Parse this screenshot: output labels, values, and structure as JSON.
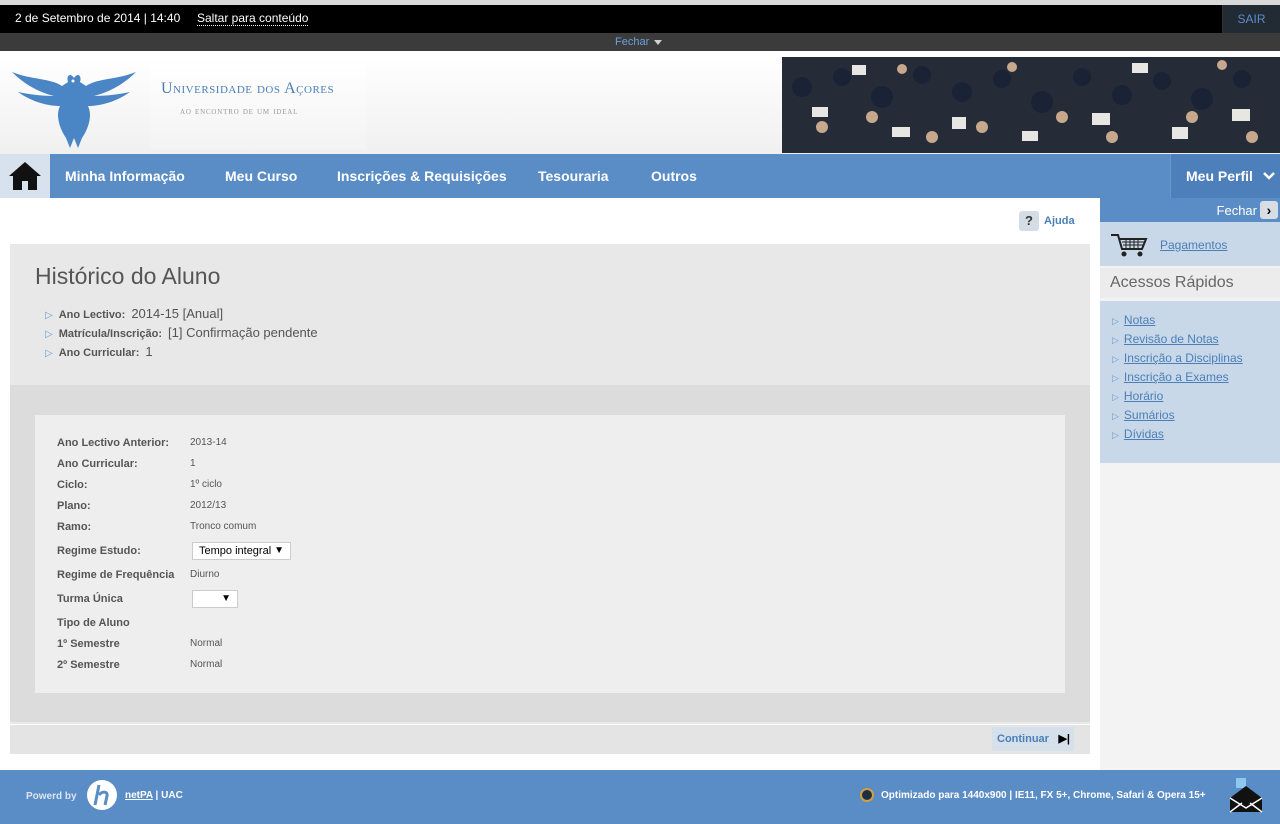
{
  "topbar": {
    "date": "2 de Setembro de 2014 | 14:40",
    "skip_link": "Saltar para conteúdo",
    "logout": "SAIR",
    "close_label": "Fechar"
  },
  "header": {
    "university_name": "Universidade dos Açores",
    "motto": "ao encontro de um ideal"
  },
  "nav": {
    "items": [
      "Minha Informação",
      "Meu Curso",
      "Inscrições & Requisições",
      "Tesouraria",
      "Outros"
    ],
    "profile": "Meu Perfil"
  },
  "help": {
    "label": "Ajuda"
  },
  "main": {
    "title": "Histórico do Aluno",
    "info": [
      {
        "key": "Ano Lectivo:",
        "value": "2014-15 [Anual]"
      },
      {
        "key": "Matrícula/Inscrição:",
        "value": "[1] Confirmação pendente"
      },
      {
        "key": "Ano Curricular:",
        "value": "1"
      }
    ],
    "fields": [
      {
        "key": "Ano Lectivo Anterior:",
        "value": "2013-14"
      },
      {
        "key": "Ano Curricular:",
        "value": "1"
      },
      {
        "key": "Ciclo:",
        "value": "1º ciclo"
      },
      {
        "key": "Plano:",
        "value": "2012/13"
      },
      {
        "key": "Ramo:",
        "value": "Tronco comum"
      },
      {
        "key": "Regime Estudo:",
        "select_value": "Tempo integral"
      },
      {
        "key": "Regime de Frequência",
        "value": "Diurno"
      },
      {
        "key": "Turma Única",
        "select_value": ""
      },
      {
        "key": "Tipo de Aluno",
        "value": ""
      },
      {
        "key": "1º Semestre",
        "value": "Normal"
      },
      {
        "key": "2º Semestre",
        "value": "Normal"
      }
    ],
    "continue_button": "Continuar"
  },
  "sidebar": {
    "close_label": "Fechar",
    "payments": "Pagamentos",
    "quick_access_title": "Acessos Rápidos",
    "links": [
      "Notas",
      "Revisão de Notas",
      "Inscrição a Disciplinas",
      "Inscrição a Exames",
      "Horário",
      "Sumários",
      "Dívidas"
    ]
  },
  "footer": {
    "powered_by": "Powerd by",
    "brand_link": "netPA",
    "brand_suffix": " | UAC",
    "optimized": "Optimizado para 1440x900 | IE11, FX 5+, Chrome, Safari & Opera 15+"
  },
  "colors": {
    "nav_blue": "#5a8cc6",
    "link_blue": "#4a7fb8",
    "sidebar_blue": "#c9d8e8"
  }
}
